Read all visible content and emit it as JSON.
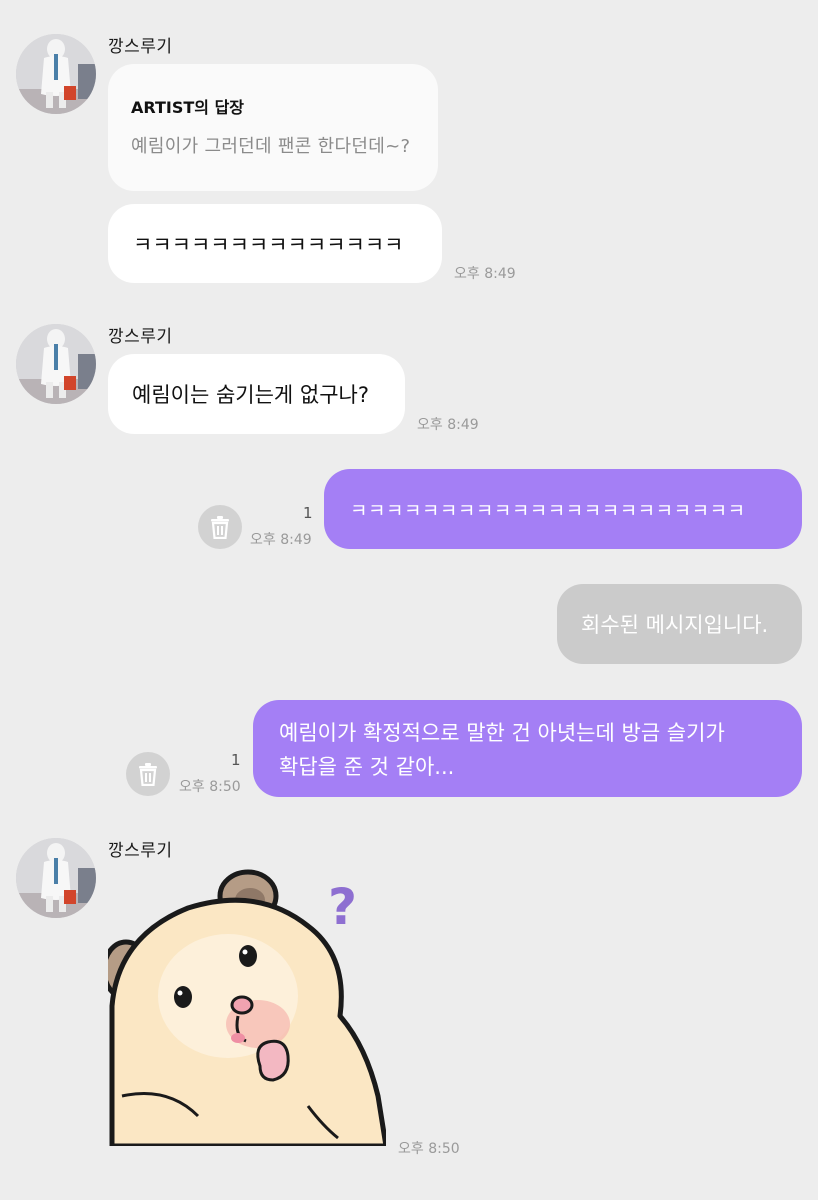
{
  "colors": {
    "background": "#ededed",
    "my_bubble": "#a47ff5",
    "other_bubble": "#ffffff",
    "recalled_bubble": "#cbcbcb",
    "timestamp": "#9a9a9a"
  },
  "messages": [
    {
      "sender": "깡스루기",
      "reply": {
        "title": "ARTIST의 답장",
        "quote": "예림이가 그러던데 팬콘 한다던데~?"
      },
      "text": "ㅋㅋㅋㅋㅋㅋㅋㅋㅋㅋㅋㅋㅋㅋ",
      "time": "오후 8:49"
    },
    {
      "sender": "깡스루기",
      "text": "예림이는 숨기는게 없구나?",
      "time": "오후 8:49"
    },
    {
      "text": "ㅋㅋㅋㅋㅋㅋㅋㅋㅋㅋㅋㅋㅋㅋㅋㅋㅋㅋㅋㅋㅋㅋ",
      "unread": "1",
      "time": "오후 8:49",
      "delete_icon": "trash-icon"
    },
    {
      "text": "회수된 메시지입니다."
    },
    {
      "line1": "예림이가 확정적으로 말한 건 아녓는데 방금 슬기가",
      "line2": "확답을 준 것 같아...",
      "unread": "1",
      "time": "오후 8:50",
      "delete_icon": "trash-icon"
    },
    {
      "sender": "깡스루기",
      "sticker": "hamster-thinking-sticker",
      "time": "오후 8:50"
    }
  ]
}
